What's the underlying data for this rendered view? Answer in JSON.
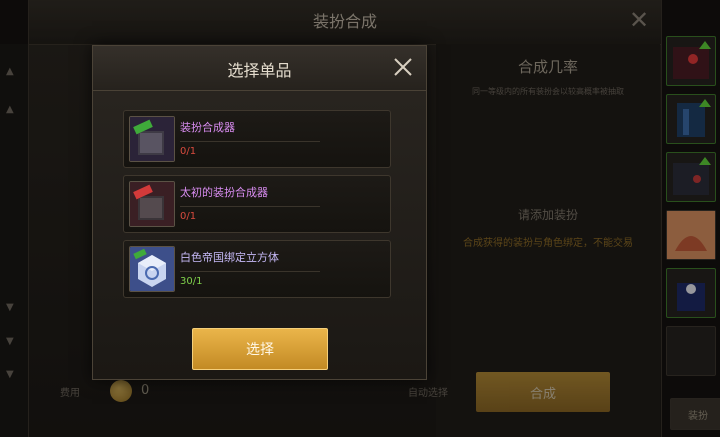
{
  "background": {
    "title": "装扮合成",
    "right_title": "合成几率",
    "right_subtitle": "同一等级内的所有装扮会以较高概率被抽取",
    "right_hint": "请添加装扮",
    "right_hint2": "合成获得的装扮与角色绑定，不能交易",
    "cost_label": "费用",
    "coin_count": "0",
    "auto_select": "自动选择",
    "synth_label": "合成",
    "side_label": "装扮"
  },
  "modal": {
    "title": "选择单品",
    "select_label": "选择",
    "items": [
      {
        "name": "装扮合成器",
        "count": "0/1",
        "name_color": "#d88cf0",
        "count_color": "#d84b3e",
        "icon": "purple-synth-device"
      },
      {
        "name": "太初的装扮合成器",
        "count": "0/1",
        "name_color": "#d88cf0",
        "count_color": "#d84b3e",
        "icon": "red-synth-device"
      },
      {
        "name": "白色帝国绑定立方体",
        "count": "30/1",
        "name_color": "#c5b8f5",
        "count_color": "#7fd04b",
        "icon": "blue-cube"
      }
    ]
  },
  "colors": {
    "accent": "#e0a83a"
  }
}
